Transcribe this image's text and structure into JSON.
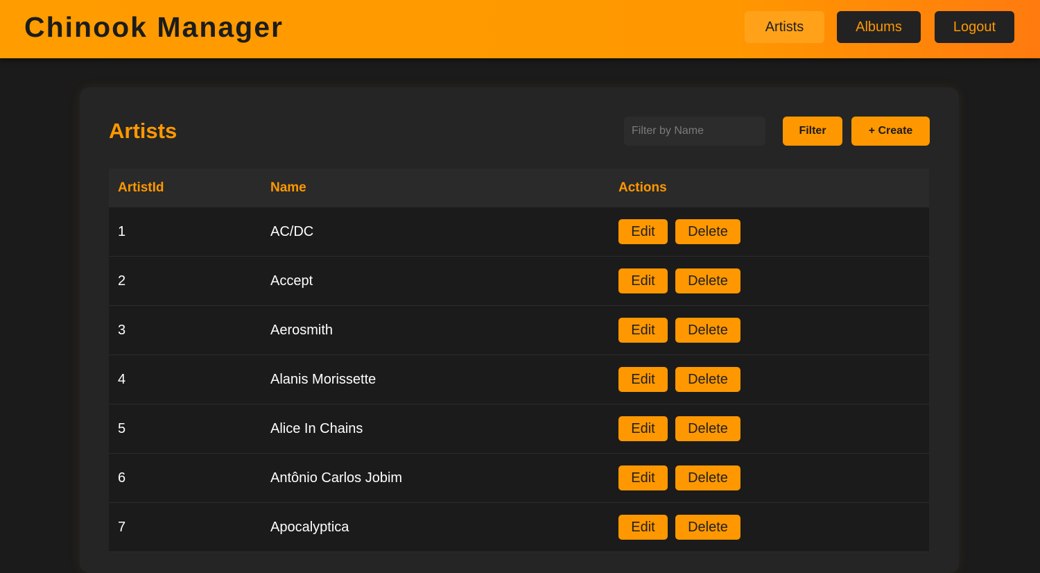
{
  "header": {
    "brand": "Chinook Manager",
    "nav": {
      "artists": "Artists",
      "albums": "Albums",
      "logout": "Logout"
    }
  },
  "panel": {
    "title": "Artists",
    "filter_placeholder": "Filter by Name",
    "filter_label": "Filter",
    "create_label": "+ Create"
  },
  "table": {
    "columns": {
      "id": "ArtistId",
      "name": "Name",
      "actions": "Actions"
    },
    "edit_label": "Edit",
    "delete_label": "Delete",
    "rows": [
      {
        "id": "1",
        "name": "AC/DC"
      },
      {
        "id": "2",
        "name": "Accept"
      },
      {
        "id": "3",
        "name": "Aerosmith"
      },
      {
        "id": "4",
        "name": "Alanis Morissette"
      },
      {
        "id": "5",
        "name": "Alice In Chains"
      },
      {
        "id": "6",
        "name": "Antônio Carlos Jobim"
      },
      {
        "id": "7",
        "name": "Apocalyptica"
      }
    ]
  },
  "colors": {
    "accent": "#ff9800",
    "background": "#1b1b1b",
    "panel": "#252525"
  }
}
